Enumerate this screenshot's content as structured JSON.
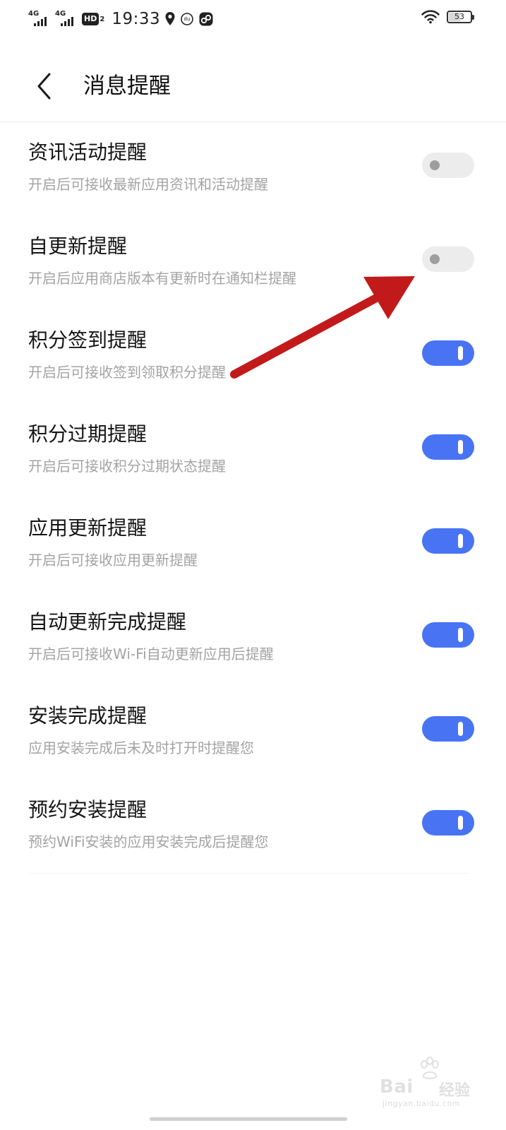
{
  "status_bar": {
    "sim1_label": "4G",
    "sim2_label": "4G",
    "hd_label": "HD",
    "hd_sub": "2",
    "time": "19:33",
    "battery_level": "53",
    "battery_fraction": 0.53,
    "icons": [
      "location-icon",
      "notification-icon",
      "link-app-icon",
      "wifi-icon",
      "battery-icon"
    ]
  },
  "header": {
    "back_icon": "chevron-left-icon",
    "title": "消息提醒"
  },
  "settings": [
    {
      "title": "资讯活动提醒",
      "description": "开启后可接收最新应用资讯和活动提醒",
      "enabled": false
    },
    {
      "title": "自更新提醒",
      "description": "开启后应用商店版本有更新时在通知栏提醒",
      "enabled": false
    },
    {
      "title": "积分签到提醒",
      "description": "开启后可接收签到领取积分提醒",
      "enabled": true
    },
    {
      "title": "积分过期提醒",
      "description": "开启后可接收积分过期状态提醒",
      "enabled": true
    },
    {
      "title": "应用更新提醒",
      "description": "开启后可接收应用更新提醒",
      "enabled": true
    },
    {
      "title": "自动更新完成提醒",
      "description": "开启后可接收Wi-Fi自动更新应用后提醒",
      "enabled": true
    },
    {
      "title": "安装完成提醒",
      "description": "应用安装完成后未及时打开时提醒您",
      "enabled": true
    },
    {
      "title": "预约安装提醒",
      "description": "预约WiFi安装的应用安装完成后提醒您",
      "enabled": true
    }
  ],
  "colors": {
    "toggle_on": "#4874f3",
    "toggle_off": "#ececec",
    "annotation_arrow": "#c21a1a"
  },
  "watermark": {
    "brand": "Bai",
    "brand_cn": "经验",
    "domain": "jingyan.baidu.com"
  }
}
